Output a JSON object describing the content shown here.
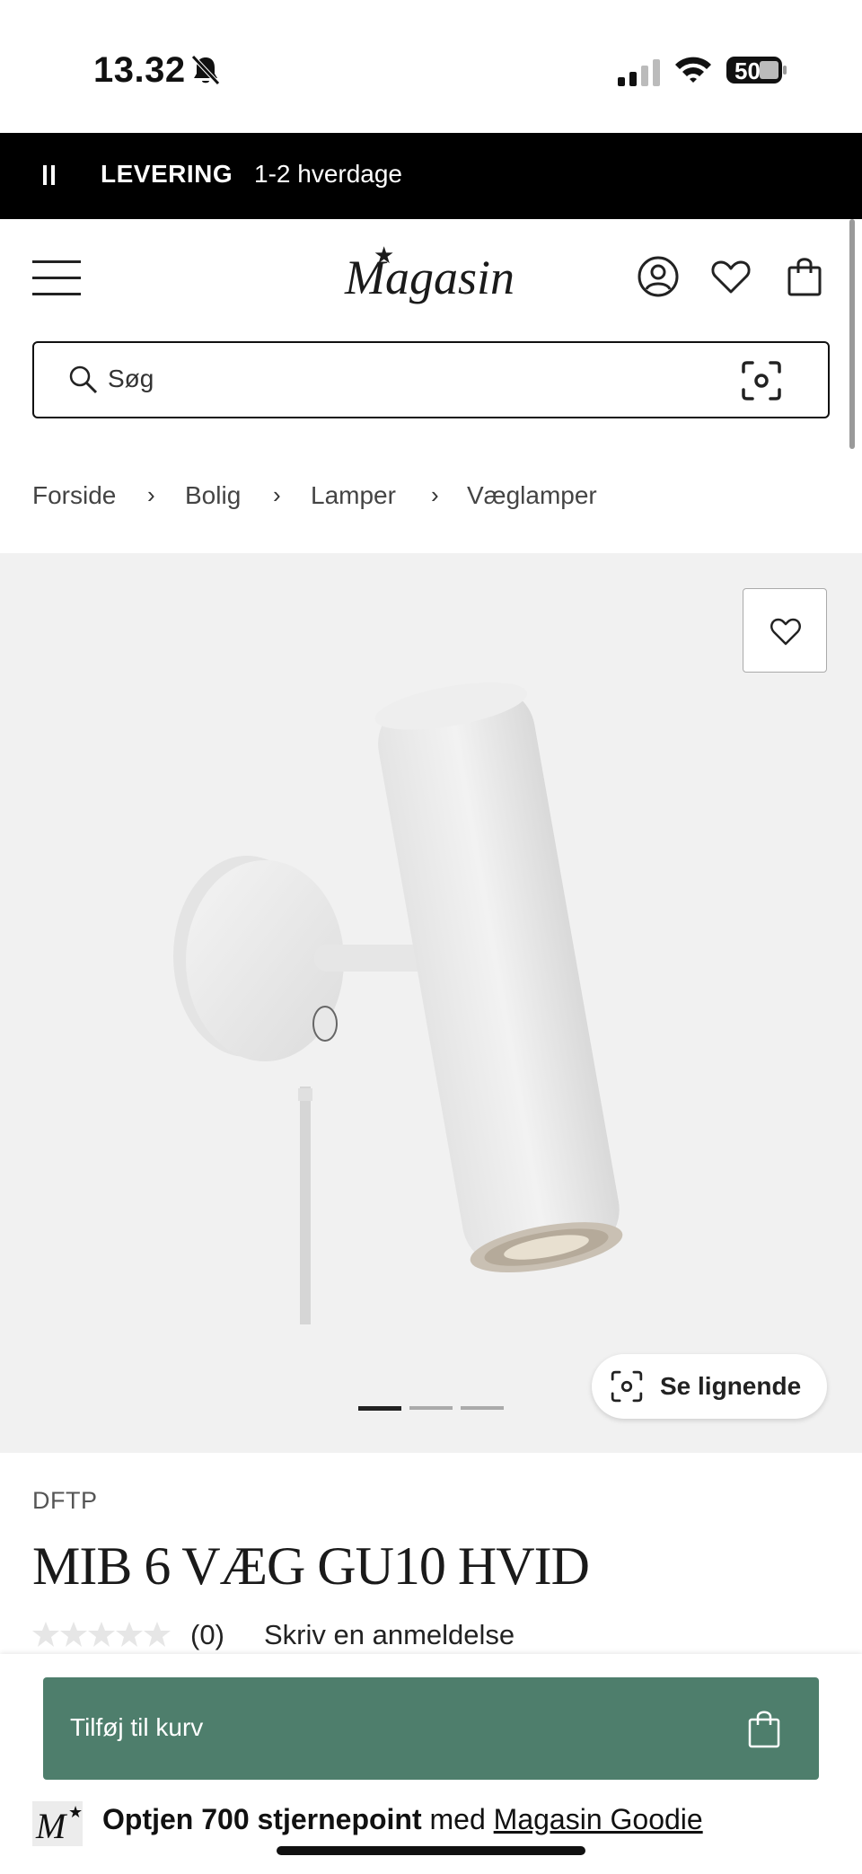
{
  "status_bar": {
    "time": "13.32",
    "battery": "50",
    "icons": [
      "bell-slash-icon",
      "signal-icon",
      "wifi-icon",
      "battery-icon"
    ]
  },
  "banner": {
    "label": "LEVERING",
    "value": "1-2 hverdage"
  },
  "header": {
    "logo": "Magasin",
    "icons": [
      "menu-icon",
      "account-icon",
      "heart-icon",
      "bag-icon"
    ]
  },
  "search": {
    "placeholder": "Søg"
  },
  "breadcrumb": {
    "items": [
      "Forside",
      "Bolig",
      "Lamper",
      "Væglamper"
    ],
    "separator": "›"
  },
  "gallery": {
    "similar_label": "Se lignende",
    "image_count": 3,
    "active_index": 0
  },
  "product": {
    "brand": "DFTP",
    "title": "MIB 6 VÆG GU10 HVID",
    "rating": 0,
    "review_count": "(0)",
    "write_review": "Skriv en anmeldelse"
  },
  "cart": {
    "add_label": "Tilføj til kurv"
  },
  "goodie": {
    "logo": "M",
    "prefix": "Optjen 700 stjernepoint",
    "middle": " med ",
    "link": "Magasin Goodie"
  },
  "colors": {
    "banner_bg": "#000000",
    "gallery_bg": "#f1f1f1",
    "cart_button": "#4e7e6c"
  }
}
